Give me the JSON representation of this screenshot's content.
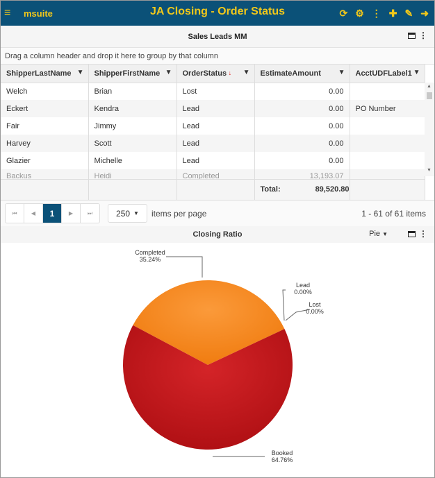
{
  "topbar": {
    "brand": "msuite",
    "title": "JA Closing - Order Status",
    "icons": [
      "menu-icon",
      "refresh-icon",
      "gear-icon",
      "more-vertical-icon",
      "plus-icon",
      "pencil-icon",
      "sign-out-icon"
    ]
  },
  "grid_panel": {
    "title": "Sales Leads MM",
    "group_hint": "Drag a column header and drop it here to group by that column",
    "columns": [
      "ShipperLastName",
      "ShipperFirstName",
      "OrderStatus",
      "EstimateAmount",
      "AcctUDFLabel1"
    ],
    "rows": [
      [
        "Welch",
        "Brian",
        "Lost",
        "0.00",
        ""
      ],
      [
        "Eckert",
        "Kendra",
        "Lead",
        "0.00",
        "PO Number"
      ],
      [
        "Fair",
        "Jimmy",
        "Lead",
        "0.00",
        ""
      ],
      [
        "Harvey",
        "Scott",
        "Lead",
        "0.00",
        ""
      ],
      [
        "Glazier",
        "Michelle",
        "Lead",
        "0.00",
        ""
      ],
      [
        "Backus",
        "Heidi",
        "Completed",
        "13,193.07",
        ""
      ]
    ],
    "total_label": "Total:",
    "total_value": "89,520.80"
  },
  "pager": {
    "current_page": "1",
    "page_size": "250",
    "items_per_page_label": "items per page",
    "range": "1 - 61 of 61 items"
  },
  "chart_panel": {
    "title": "Closing Ratio",
    "type_select": "Pie"
  },
  "chart_data": {
    "type": "pie",
    "title": "Closing Ratio",
    "slices": [
      {
        "name": "Completed",
        "value": 35.24,
        "label": "35.24%",
        "color": "#f7861c"
      },
      {
        "name": "Booked",
        "value": 64.76,
        "label": "64.76%",
        "color": "#c8191b"
      },
      {
        "name": "Lost",
        "value": 0,
        "label": "0.00%",
        "color": "#c8191b"
      },
      {
        "name": "Lead",
        "value": 0,
        "label": "0.00%",
        "color": "#c8191b"
      }
    ]
  },
  "colors": {
    "header_bg": "#0b5178",
    "header_text": "#f2c81a",
    "sort_indicator": "#e02020"
  }
}
